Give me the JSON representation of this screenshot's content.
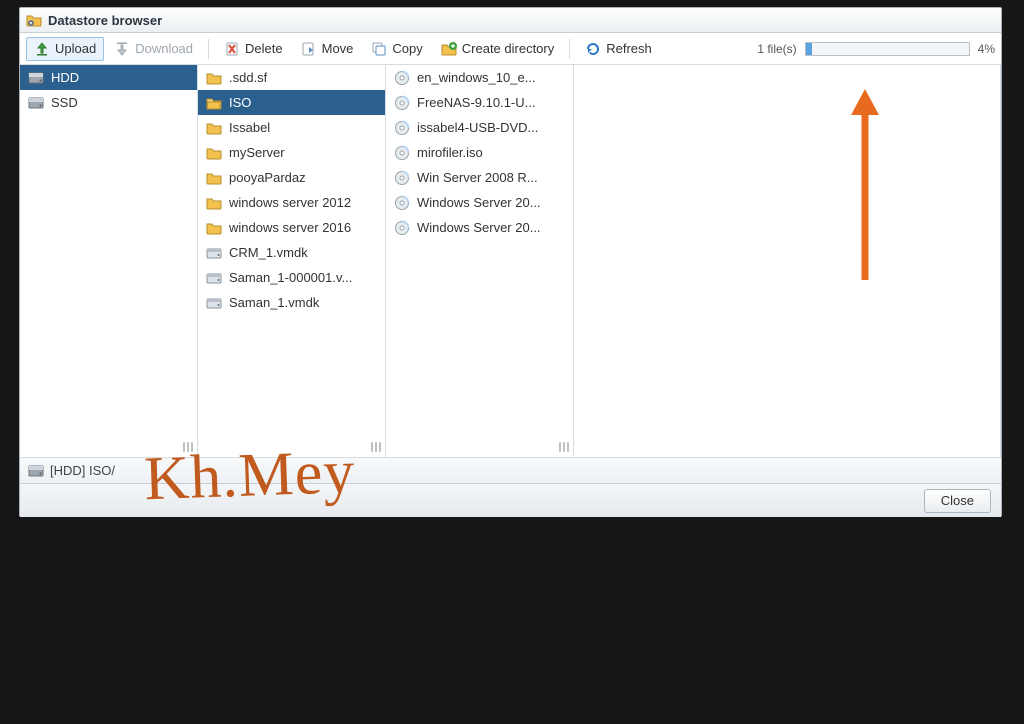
{
  "title": "Datastore browser",
  "toolbar": {
    "upload": "Upload",
    "download": "Download",
    "delete": "Delete",
    "move": "Move",
    "copy": "Copy",
    "createdir": "Create directory",
    "refresh": "Refresh"
  },
  "upload_status": {
    "files": "1 file(s)",
    "percent": "4%",
    "value": 4
  },
  "cols": {
    "roots": [
      {
        "label": "HDD",
        "kind": "disk",
        "sel": true
      },
      {
        "label": "SSD",
        "kind": "disk",
        "sel": false
      }
    ],
    "hdd": [
      {
        "label": ".sdd.sf",
        "kind": "folder"
      },
      {
        "label": "ISO",
        "kind": "folder",
        "sel": true
      },
      {
        "label": "Issabel",
        "kind": "folder"
      },
      {
        "label": "myServer",
        "kind": "folder"
      },
      {
        "label": "pooyaPardaz",
        "kind": "folder"
      },
      {
        "label": "windows server 2012",
        "kind": "folder"
      },
      {
        "label": "windows server 2016",
        "kind": "folder"
      },
      {
        "label": "CRM_1.vmdk",
        "kind": "vmdk"
      },
      {
        "label": "Saman_1-000001.v...",
        "kind": "vmdk"
      },
      {
        "label": "Saman_1.vmdk",
        "kind": "vmdk"
      }
    ],
    "iso": [
      {
        "label": "en_windows_10_e...",
        "kind": "iso"
      },
      {
        "label": "FreeNAS-9.10.1-U...",
        "kind": "iso"
      },
      {
        "label": "issabel4-USB-DVD...",
        "kind": "iso"
      },
      {
        "label": "mirofiler.iso",
        "kind": "iso"
      },
      {
        "label": "Win Server 2008 R...",
        "kind": "iso"
      },
      {
        "label": "Windows Server 20...",
        "kind": "iso"
      },
      {
        "label": "Windows Server 20...",
        "kind": "iso"
      }
    ]
  },
  "path": "[HDD] ISO/",
  "footer": {
    "close": "Close"
  },
  "signature": "Kh.Mey"
}
